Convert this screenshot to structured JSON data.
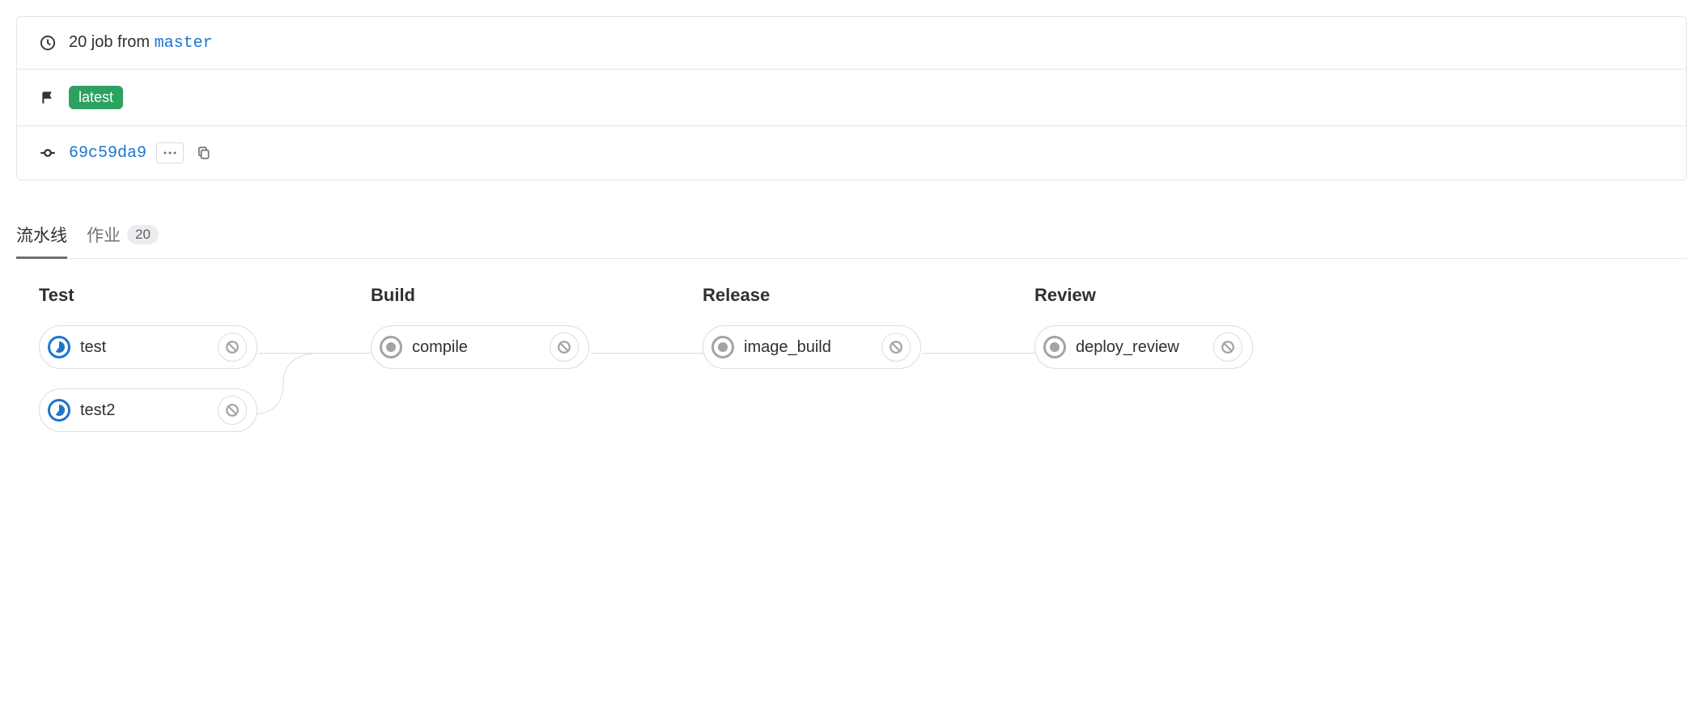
{
  "header": {
    "job_count_text": "20 job from ",
    "branch": "master",
    "latest_badge": "latest",
    "commit_sha": "69c59da9"
  },
  "tabs": {
    "pipeline": "流水线",
    "jobs": "作业",
    "jobs_count": "20"
  },
  "stages": [
    {
      "title": "Test",
      "jobs": [
        {
          "name": "test",
          "status": "running"
        },
        {
          "name": "test2",
          "status": "running"
        }
      ]
    },
    {
      "title": "Build",
      "jobs": [
        {
          "name": "compile",
          "status": "created"
        }
      ]
    },
    {
      "title": "Release",
      "jobs": [
        {
          "name": "image_build",
          "status": "created"
        }
      ]
    },
    {
      "title": "Review",
      "jobs": [
        {
          "name": "deploy_review",
          "status": "created"
        }
      ]
    }
  ]
}
